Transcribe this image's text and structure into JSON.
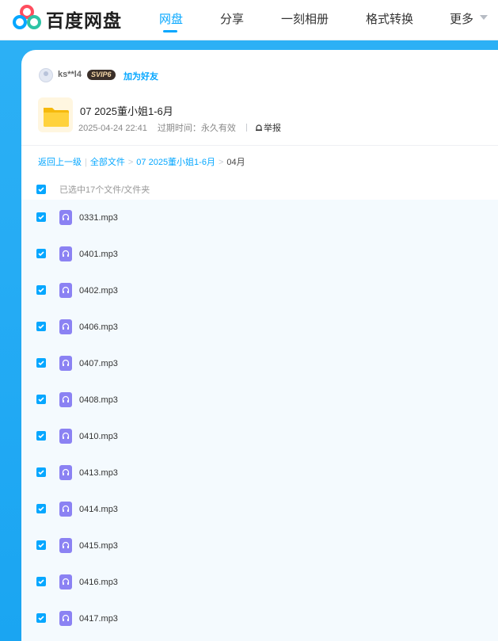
{
  "header": {
    "brand": "百度网盘",
    "nav": [
      "网盘",
      "分享",
      "一刻相册",
      "格式转换",
      "更多"
    ],
    "active_nav": "网盘"
  },
  "share": {
    "username": "ks**l4",
    "badge": "SVIP6",
    "add_friend": "加为好友",
    "folder_title": "07 2025董小姐1-6月",
    "date": "2025-04-24 22:41",
    "expiry_label": "过期时间：永久有效",
    "report": "举报"
  },
  "breadcrumb": {
    "back": "返回上一级",
    "all_files": "全部文件",
    "folder": "07 2025董小姐1-6月",
    "current": "04月"
  },
  "selection": {
    "text": "已选中17个文件/文件夹"
  },
  "files": [
    {
      "name": "0331.mp3"
    },
    {
      "name": "0401.mp3"
    },
    {
      "name": "0402.mp3"
    },
    {
      "name": "0406.mp3"
    },
    {
      "name": "0407.mp3"
    },
    {
      "name": "0408.mp3"
    },
    {
      "name": "0410.mp3"
    },
    {
      "name": "0413.mp3"
    },
    {
      "name": "0414.mp3"
    },
    {
      "name": "0415.mp3"
    },
    {
      "name": "0416.mp3"
    },
    {
      "name": "0417.mp3"
    }
  ],
  "colors": {
    "accent": "#06a7ff",
    "banner": "#1aa5f2",
    "audio_icon": "#8b82f3"
  }
}
